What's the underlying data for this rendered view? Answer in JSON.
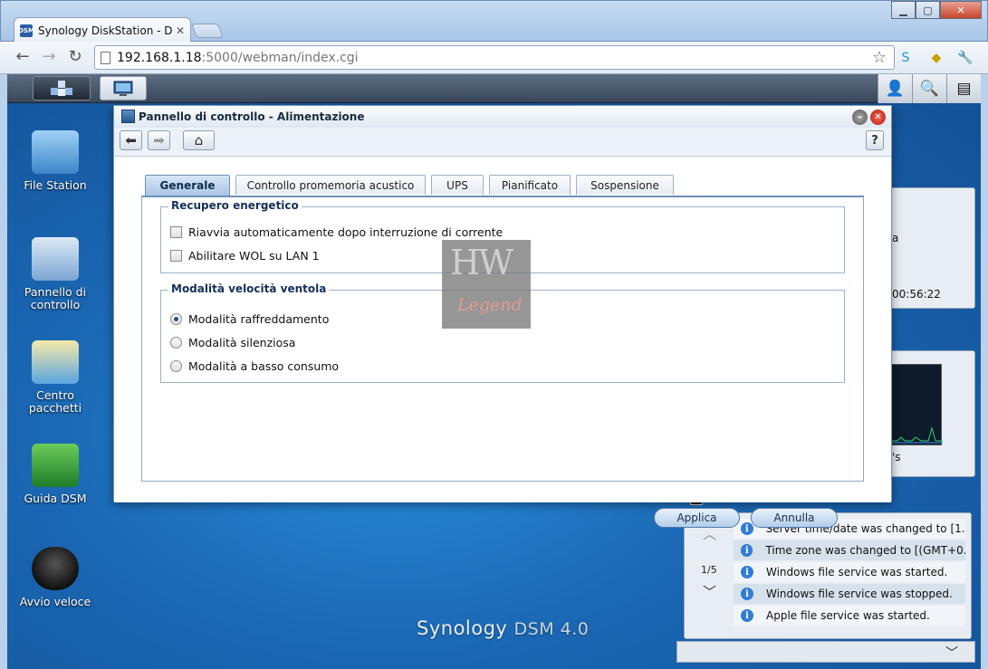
{
  "browser": {
    "tab_title": "Synology DiskStation - Disk",
    "tab_favicon": "DSM",
    "url_host": "192.168.1.18",
    "url_rest": ":5000/webman/index.cgi"
  },
  "desktop": {
    "icons": [
      {
        "name": "file-station",
        "label": "File Station",
        "label2": ""
      },
      {
        "name": "pannello-di-controllo",
        "label": "Pannello di",
        "label2": "controllo"
      },
      {
        "name": "centro-pacchetti",
        "label": "Centro",
        "label2": "pacchetti"
      },
      {
        "name": "guida-dsm",
        "label": "Guida DSM",
        "label2": ""
      },
      {
        "name": "avvio-veloce",
        "label": "Avvio veloce",
        "label2": ""
      }
    ],
    "brand": "Synology",
    "brand_suffix": "DSM 4.0"
  },
  "widgets": {
    "clock_fragment": "00:56:22",
    "a_fragment": "a",
    "s_fragment": "'s",
    "notifications": {
      "page": "1/5",
      "items": [
        "Server time/date was changed to [1...",
        "Time zone was changed to [(GMT+0...",
        "Windows file service was started.",
        "Windows file service was stopped.",
        "Apple file service was started."
      ]
    }
  },
  "dialog": {
    "title": "Pannello di controllo - Alimentazione",
    "tabs": [
      "Generale",
      "Controllo promemoria acustico",
      "UPS",
      "Pianificato",
      "Sospensione"
    ],
    "active_tab": "Generale",
    "group1": {
      "legend": "Recupero energetico",
      "options": [
        "Riavvia automaticamente dopo interruzione di corrente",
        "Abilitare WOL su LAN 1"
      ],
      "checked": [
        false,
        false
      ]
    },
    "group2": {
      "legend": "Modalità velocità ventola",
      "options": [
        "Modalità raffreddamento",
        "Modalità silenziosa",
        "Modalità a basso consumo"
      ],
      "selected_index": 0
    },
    "apply_label": "Applica",
    "cancel_label": "Annulla",
    "help_label": "?"
  },
  "watermark": {
    "top": "HW",
    "bottom": "Legend"
  },
  "colors": {
    "desktop_blue": "#1f6fba",
    "accent": "#2f7dd4"
  }
}
